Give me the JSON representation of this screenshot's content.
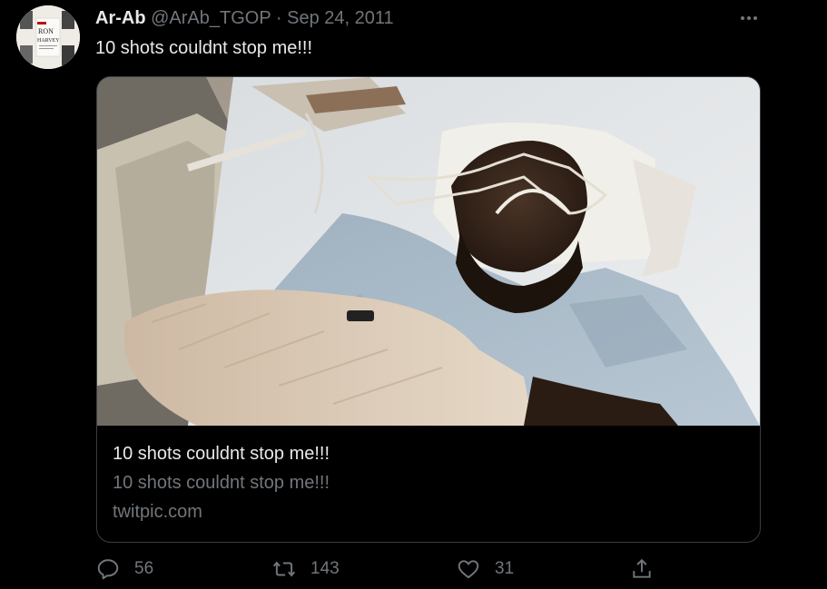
{
  "tweet": {
    "display_name": "Ar-Ab",
    "handle": "@ArAb_TGOP",
    "separator": "·",
    "date": "Sep 24, 2011",
    "text": "10 shots couldnt stop me!!!"
  },
  "avatar": {
    "book_cover_text_top": "RON",
    "book_cover_text_bottom": "HARVEY"
  },
  "card": {
    "title": "10 shots couldnt stop me!!!",
    "description": "10 shots couldnt stop me!!!",
    "domain": "twitpic.com"
  },
  "actions": {
    "replies": "56",
    "retweets": "143",
    "likes": "31"
  },
  "colors": {
    "background": "#000000",
    "primary_text": "#e7e9ea",
    "secondary_text": "#71767b",
    "card_border": "#3a3f44"
  },
  "icons": {
    "more": "more-horizontal-icon",
    "reply": "reply-icon",
    "retweet": "retweet-icon",
    "like": "heart-icon",
    "share": "share-icon"
  }
}
